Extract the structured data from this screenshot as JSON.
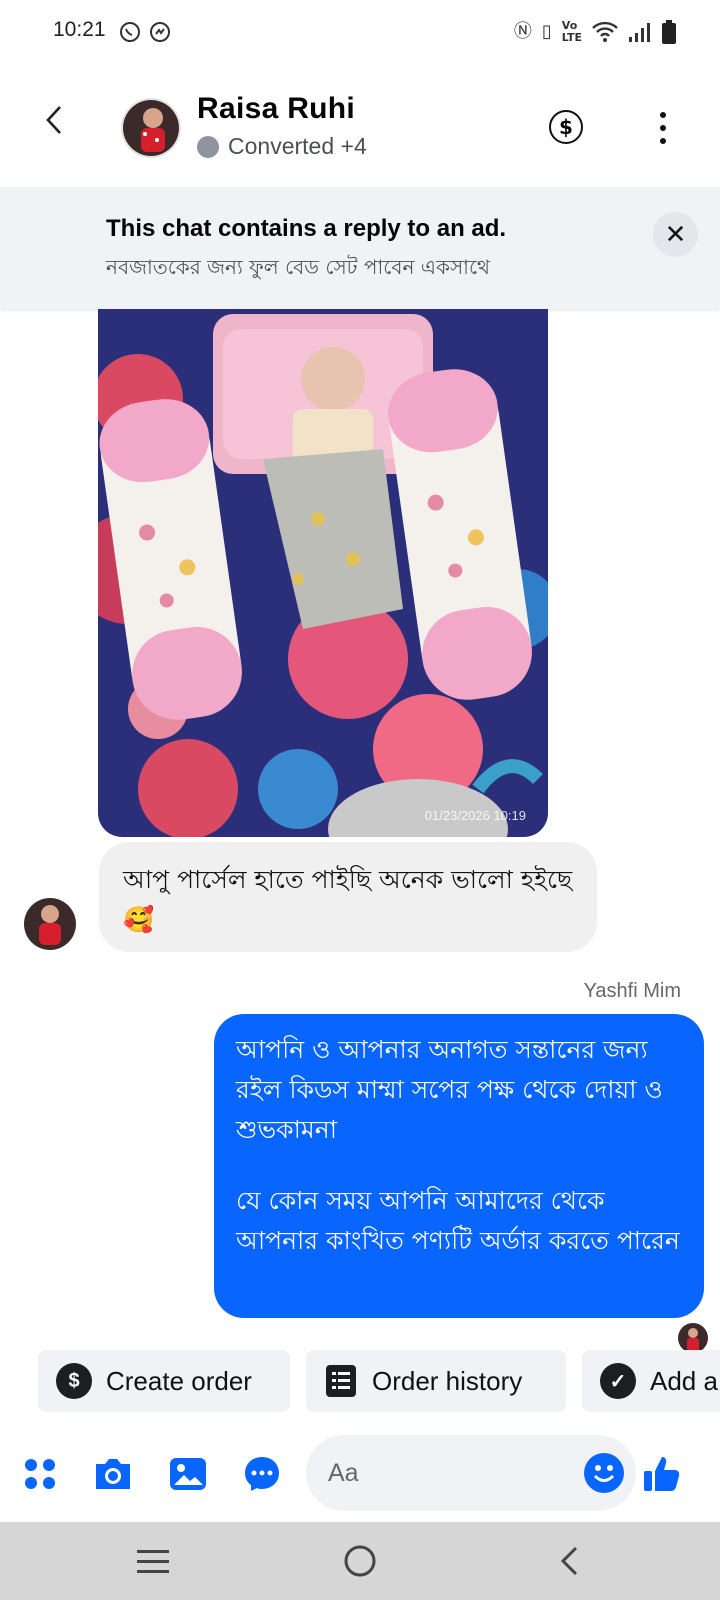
{
  "status_bar": {
    "time": "10:21",
    "left_icons": [
      "whatsapp-icon",
      "messenger-status-icon"
    ],
    "right_icons": [
      "nfc-icon",
      "vibrate-icon",
      "volte-icon",
      "wifi-icon",
      "signal-icon",
      "battery-icon"
    ]
  },
  "header": {
    "contact_name": "Raisa Ruhi",
    "status_label": "Converted +4",
    "status_color": "#8d949e",
    "icons": [
      "back-icon",
      "dollar-icon",
      "more-vertical-icon"
    ]
  },
  "ad_banner": {
    "title": "This chat contains a reply to an ad.",
    "subtitle": "নবজাতকের জন্য ফুল বেড সেট পাবেন একসাথে",
    "close_icon": "close-icon"
  },
  "messages": {
    "photo_timestamp": "01/23/2026 10:19",
    "incoming_text": "আপু পার্সেল হাতে পাইছি অনেক ভালো হইছে 🥰",
    "sender_name": "Yashfi Mim",
    "outgoing_paragraph_1": "আপনি ও আপনার অনাগত সন্তানের জন্য রইল কিডস মাম্মা সপের পক্ষ থেকে দোয়া ও শুভকামনা",
    "outgoing_paragraph_2": "যে কোন সময় আপনি আমাদের থেকে আপনার কাংখিত পণ্যটি অর্ডার করতে পারেন",
    "outgoing_color": "#0866ff"
  },
  "quick_actions": {
    "create_order": "Create order",
    "order_history": "Order history",
    "add_label": "Add a"
  },
  "composer": {
    "placeholder": "Aa",
    "icons": [
      "apps-grid-icon",
      "camera-icon",
      "gallery-icon",
      "chat-bubble-icon",
      "emoji-icon",
      "thumbs-up-icon"
    ],
    "accent": "#0866ff"
  },
  "nav_bar": {
    "icons": [
      "recents-icon",
      "home-icon",
      "back-icon"
    ]
  }
}
